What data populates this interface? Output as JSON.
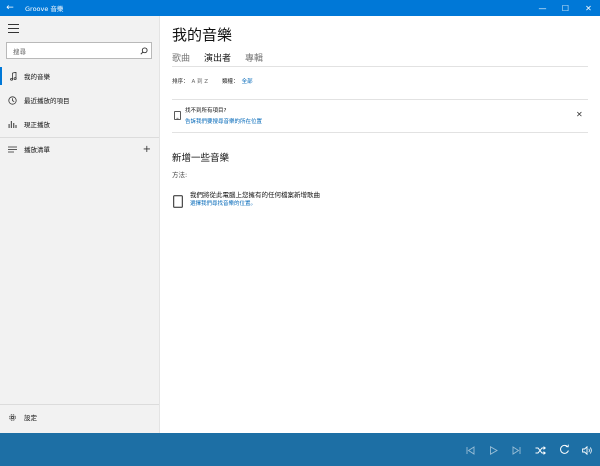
{
  "window": {
    "title": "Groove 音樂",
    "back_glyph": "←",
    "minimize_glyph": "—",
    "maximize_glyph": "☐",
    "close_glyph": "✕"
  },
  "sidebar": {
    "search_placeholder": "搜尋",
    "items": [
      {
        "label": "我的音樂",
        "icon": "music-note-icon",
        "active": true
      },
      {
        "label": "最近播放的項目",
        "icon": "clock-icon",
        "active": false
      },
      {
        "label": "現正播放",
        "icon": "equalizer-icon",
        "active": false
      },
      {
        "label": "播放清單",
        "icon": "playlist-icon",
        "active": false
      }
    ],
    "add_playlist_glyph": "+",
    "settings_label": "設定"
  },
  "main": {
    "title": "我的音樂",
    "tabs": [
      {
        "label": "歌曲",
        "active": false
      },
      {
        "label": "演出者",
        "active": true
      },
      {
        "label": "專輯",
        "active": false
      }
    ],
    "sort_label": "排序：",
    "sort_value": "A 到 Z",
    "genre_label": "類權：",
    "genre_value": "全部",
    "notice": {
      "title": "找不到所有項目?",
      "link": "告訴我們要搜尋音樂的所在位置",
      "close_glyph": "✕"
    },
    "add_heading": "新增一些音樂",
    "methods_label": "方法:",
    "method_text": "我們將從此電腦上您擁有的任何檔案新增歌曲",
    "method_link": "選擇我們尋找音樂的位置。"
  },
  "player": {
    "buttons": [
      "previous-icon",
      "play-icon",
      "next-icon",
      "shuffle-icon",
      "repeat-icon",
      "volume-icon"
    ]
  },
  "colors": {
    "accent": "#0078d7",
    "link": "#0067b8",
    "player_bg": "#1d6fa5",
    "sidebar_bg": "#f2f2f2"
  }
}
